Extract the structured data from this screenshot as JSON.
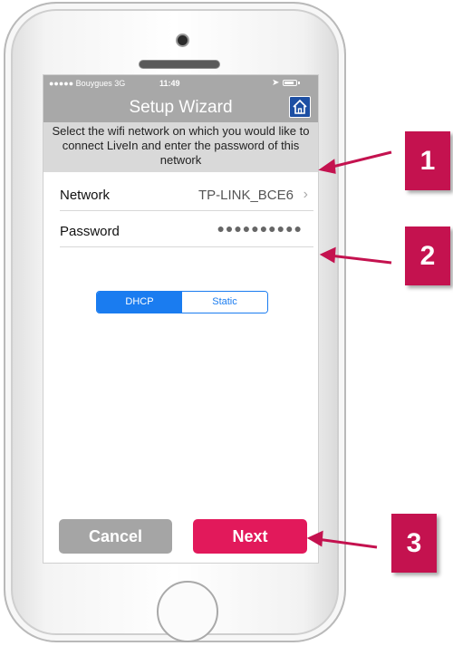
{
  "status_bar": {
    "carrier": "●●●●● Bouygues  3G",
    "time": "11:49"
  },
  "nav": {
    "title": "Setup Wizard",
    "home_icon": "home-icon"
  },
  "intro_text": "Select the wifi network on which you would like to connect LiveIn and enter the password of this network",
  "form": {
    "network_label": "Network",
    "network_value": "TP-LINK_BCE6",
    "password_label": "Password",
    "password_mask": "●●●●●●●●●●"
  },
  "ip_mode": {
    "options": [
      "DHCP",
      "Static"
    ],
    "selected": "DHCP"
  },
  "buttons": {
    "cancel": "Cancel",
    "next": "Next"
  },
  "callouts": [
    "1",
    "2",
    "3"
  ],
  "colors": {
    "accent_pink": "#e2195b",
    "callout_crimson": "#c4124f",
    "segment_blue": "#1a7cf0",
    "header_grey": "#a8a8a8"
  }
}
